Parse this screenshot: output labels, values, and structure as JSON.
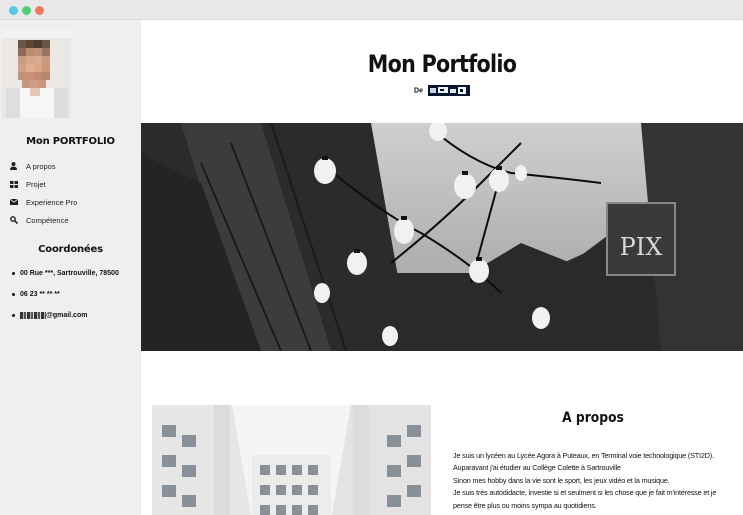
{
  "window": {
    "controls": [
      "close",
      "minimize",
      "maximize"
    ]
  },
  "sidebar": {
    "title": "Mon PORTFOLIO",
    "nav": [
      {
        "label": "A propos",
        "icon": "user-icon"
      },
      {
        "label": "Projet",
        "icon": "grid-icon"
      },
      {
        "label": "Experience Pro",
        "icon": "envelope-icon"
      },
      {
        "label": "Compétence",
        "icon": "search-icon"
      }
    ],
    "coord_title": "Coordonées",
    "coords": [
      "00 Rue ***, Sartrouville, 78500",
      "06 23 ** ** **",
      "@gmail.com"
    ]
  },
  "main": {
    "title": "Mon Portfolio",
    "byline_prefix": "De",
    "about_title": "A propos",
    "about_lines": [
      "Je suis un lycéen au Lycée Agora à Puteaux, en Terminal voie technologique (STI2D).",
      "Auparavant j'ai étudier au Collège Colette à Sartrouville",
      "Sinon mes hobby dans la vie sont le sport, les jeux vidéo et la musique.",
      "Je suis très autodidacte, investie si et seulment si les chose que je fait m'intéresse et je",
      "pense être plus ou moins sympa au quotidiens."
    ]
  },
  "hero": {
    "sign_text": "PIX"
  },
  "colors": {
    "sidebar_bg": "#efefef",
    "text": "#111111",
    "close": "#53c7e4",
    "minimize": "#4cd17a",
    "maximize": "#ef7a5b"
  }
}
